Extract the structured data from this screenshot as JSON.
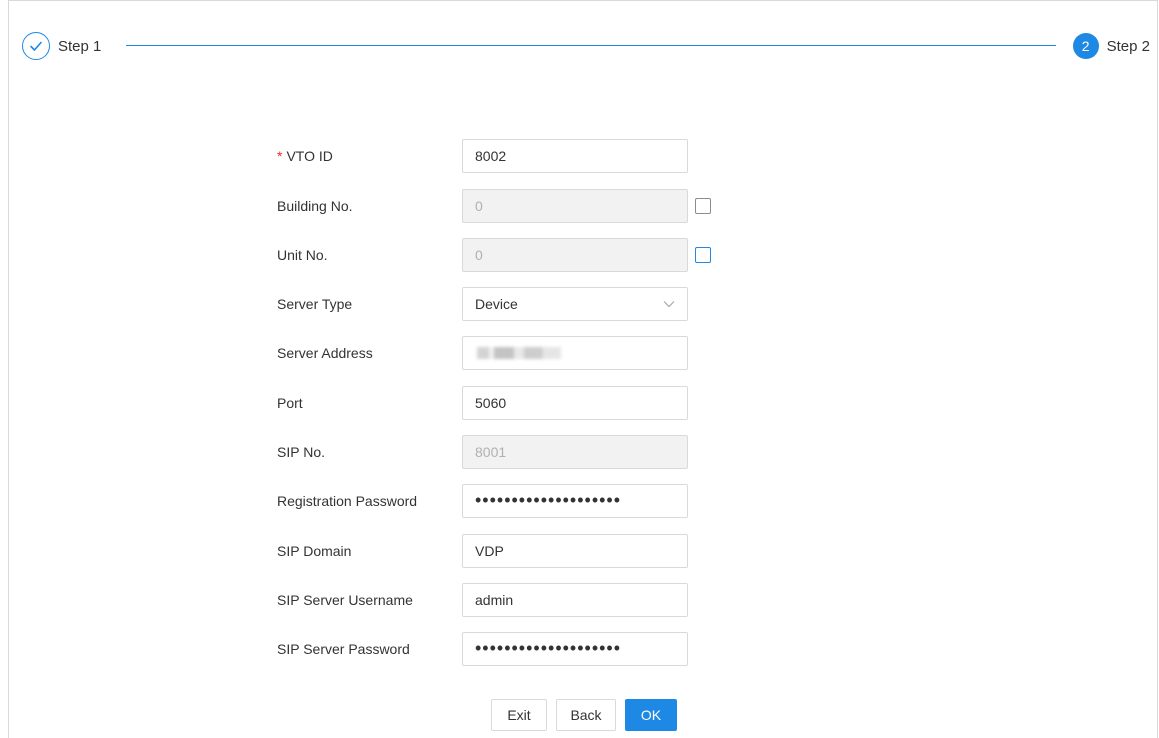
{
  "steps": {
    "step1": {
      "label": "Step 1",
      "status": "done"
    },
    "step2": {
      "label": "Step 2",
      "number": "2",
      "status": "active"
    }
  },
  "form": {
    "vto_id": {
      "label": "VTO ID",
      "required_mark": "*",
      "value": "8002"
    },
    "building_no": {
      "label": "Building No.",
      "value": "0",
      "disabled": true,
      "checkbox_checked": false
    },
    "unit_no": {
      "label": "Unit No.",
      "value": "0",
      "disabled": true,
      "checkbox_checked": false
    },
    "server_type": {
      "label": "Server Type",
      "value": "Device"
    },
    "server_address": {
      "label": "Server Address",
      "value": ""
    },
    "port": {
      "label": "Port",
      "value": "5060"
    },
    "sip_no": {
      "label": "SIP No.",
      "value": "8001",
      "disabled": true
    },
    "registration_password": {
      "label": "Registration Password",
      "value": "••••••••••••••••••••"
    },
    "sip_domain": {
      "label": "SIP Domain",
      "value": "VDP"
    },
    "sip_server_username": {
      "label": "SIP Server Username",
      "value": "admin"
    },
    "sip_server_password": {
      "label": "SIP Server Password",
      "value": "••••••••••••••••••••"
    }
  },
  "buttons": {
    "exit": "Exit",
    "back": "Back",
    "ok": "OK"
  },
  "colors": {
    "primary": "#1e88e5",
    "required": "#f5222d",
    "disabled_bg": "#f2f2f2"
  }
}
